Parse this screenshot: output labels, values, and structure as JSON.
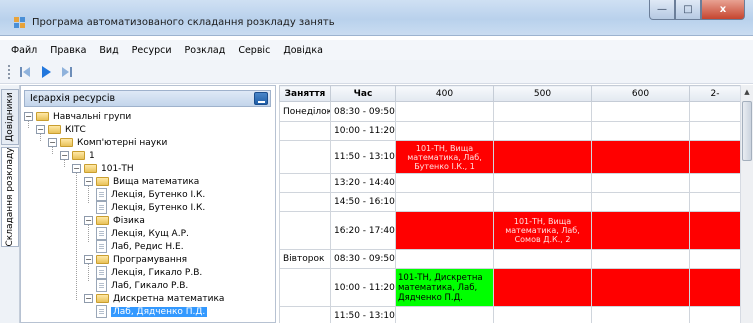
{
  "window": {
    "title": "Програма автоматизованого складання розкладу занять",
    "controls": [
      "minimize",
      "maximize",
      "close"
    ]
  },
  "menu": [
    "Файл",
    "Правка",
    "Вид",
    "Ресурси",
    "Розклад",
    "Сервіс",
    "Довідка"
  ],
  "toolbar": {
    "buttons": [
      "arrow-left-icon",
      "play-icon",
      "arrow-right-icon"
    ]
  },
  "side_tabs": [
    "Довідники",
    "Складання розкладу"
  ],
  "resource_panel": {
    "title": "Ієрархія ресурсів",
    "tree": [
      {
        "label": "Навчальні групи",
        "type": "folder",
        "expanded": true
      },
      {
        "label": "КІТС",
        "type": "folder",
        "expanded": true
      },
      {
        "label": "Комп'ютерні науки",
        "type": "folder",
        "expanded": true
      },
      {
        "label": "1",
        "type": "folder",
        "expanded": true
      },
      {
        "label": "101-ТН",
        "type": "folder",
        "expanded": true
      },
      {
        "label": "Вища математика",
        "type": "folder",
        "expanded": true
      },
      {
        "label": "Лекція, Бутенко І.К.",
        "type": "item"
      },
      {
        "label": "Лекція, Бутенко І.К.",
        "type": "item"
      },
      {
        "label": "Фізика",
        "type": "folder",
        "expanded": true
      },
      {
        "label": "Лекція, Кущ А.Р.",
        "type": "item"
      },
      {
        "label": "Лаб, Редис Н.Е.",
        "type": "item"
      },
      {
        "label": "Програмування",
        "type": "folder",
        "expanded": true
      },
      {
        "label": "Лекція, Гикало Р.В.",
        "type": "item"
      },
      {
        "label": "Лаб, Гикало Р.В.",
        "type": "item"
      },
      {
        "label": "Дискретна математика",
        "type": "folder",
        "expanded": true
      },
      {
        "label": "Лаб, Дядченко П.Д.",
        "type": "item",
        "selected": true
      }
    ]
  },
  "schedule": {
    "headers": [
      "Заняття",
      "Час",
      "400",
      "500",
      "600",
      "2-"
    ],
    "rows": [
      {
        "day": "Понеділок",
        "time": "08:30 - 09:50",
        "cells": [
          "",
          "",
          "",
          ""
        ]
      },
      {
        "day": "",
        "time": "10:00 - 11:20",
        "cells": [
          "",
          "",
          "",
          ""
        ]
      },
      {
        "day": "",
        "time": "11:50 - 13:10",
        "cells": [
          "101-ТН, Вища математика, Лаб, Бутенко І.К., 1",
          "",
          "",
          ""
        ]
      },
      {
        "day": "",
        "time": "13:20 - 14:40",
        "cells": [
          "",
          "",
          "",
          ""
        ]
      },
      {
        "day": "",
        "time": "14:50 - 16:10",
        "cells": [
          "",
          "",
          "",
          ""
        ]
      },
      {
        "day": "",
        "time": "16:20 - 17:40",
        "cells": [
          "",
          "101-ТН, Вища математика, Лаб, Сомов Д.К., 2",
          "",
          ""
        ]
      },
      {
        "day": "Вівторок",
        "time": "08:30 - 09:50",
        "cells": [
          "",
          "",
          "",
          ""
        ]
      },
      {
        "day": "",
        "time": "10:00 - 11:20",
        "cells": [
          "101-ТН, Дискретна математика, Лаб, Дядченко П.Д.",
          "",
          "",
          ""
        ]
      },
      {
        "day": "",
        "time": "11:50 - 13:10",
        "cells": [
          "",
          "",
          "",
          ""
        ]
      }
    ],
    "colors": {
      "conflict": "#ff0000",
      "ok": "#00ff00"
    }
  }
}
